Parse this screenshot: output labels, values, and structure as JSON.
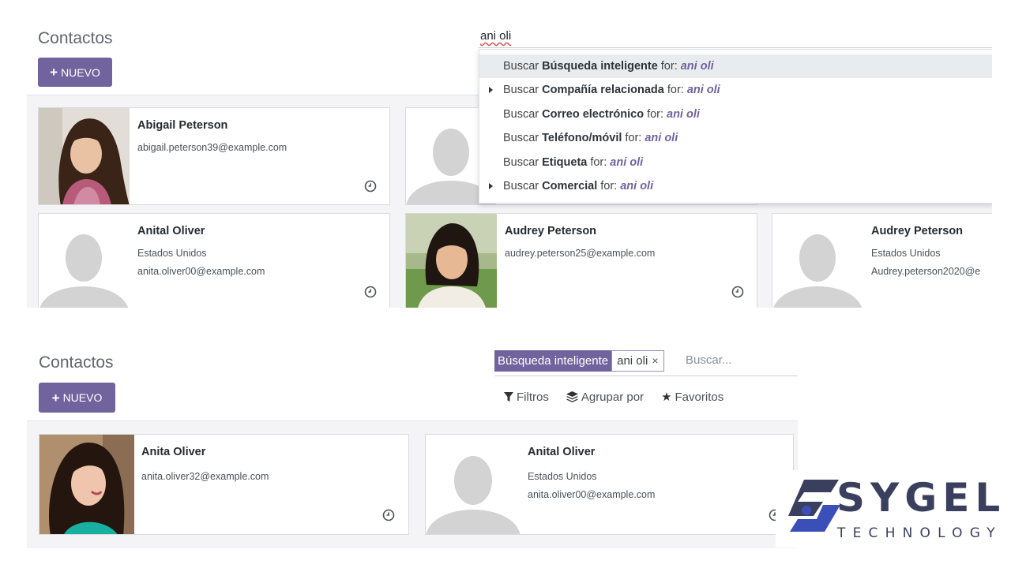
{
  "panel1": {
    "title": "Contactos",
    "new_button": "NUEVO",
    "search_typed": "ani oli",
    "dropdown": [
      {
        "prefix": "Buscar",
        "field": "Búsqueda inteligente",
        "for": "for:",
        "value": "ani oli",
        "has_caret": false,
        "active": true
      },
      {
        "prefix": "Buscar",
        "field": "Compañía relacionada",
        "for": "for:",
        "value": "ani oli",
        "has_caret": true,
        "active": false
      },
      {
        "prefix": "Buscar",
        "field": "Correo electrónico",
        "for": "for:",
        "value": "ani oli",
        "has_caret": false,
        "active": false
      },
      {
        "prefix": "Buscar",
        "field": "Teléfono/móvil",
        "for": "for:",
        "value": "ani oli",
        "has_caret": false,
        "active": false
      },
      {
        "prefix": "Buscar",
        "field": "Etiqueta",
        "for": "for:",
        "value": "ani oli",
        "has_caret": false,
        "active": false
      },
      {
        "prefix": "Buscar",
        "field": "Comercial",
        "for": "for:",
        "value": "ani oli",
        "has_caret": true,
        "active": false
      }
    ],
    "cards": [
      {
        "name": "Abigail Peterson",
        "line1": "abigail.peterson39@example.com",
        "line2": ""
      },
      {
        "name": "Anital Oliver",
        "line1": "Estados Unidos",
        "line2": "anita.oliver00@example.com"
      },
      {
        "name": "Audrey Peterson",
        "line1": "audrey.peterson25@example.com",
        "line2": ""
      },
      {
        "name": "Audrey Peterson",
        "line1": "Estados Unidos",
        "line2": "Audrey.peterson2020@e"
      }
    ]
  },
  "panel2": {
    "title": "Contactos",
    "new_button": "NUEVO",
    "facet_label": "Búsqueda inteligente",
    "facet_value": "ani oli",
    "facet_remove": "×",
    "search_placeholder": "Buscar...",
    "filters": "Filtros",
    "group_by": "Agrupar por",
    "favorites": "Favoritos",
    "cards": [
      {
        "name": "Anita Oliver",
        "line1": "anita.oliver32@example.com",
        "line2": ""
      },
      {
        "name": "Anital Oliver",
        "line1": "Estados Unidos",
        "line2": "anita.oliver00@example.com"
      }
    ]
  },
  "logo": {
    "word": "SYGEL",
    "sub": "TECHNOLOGY"
  },
  "colors": {
    "accent": "#71639e",
    "logo": "#3b3f5e",
    "logo_blue": "#3b4fb8"
  },
  "icons": [
    "plus-icon",
    "clock-icon",
    "filter-icon",
    "layers-icon",
    "star-icon",
    "caret-right-icon",
    "close-icon"
  ]
}
